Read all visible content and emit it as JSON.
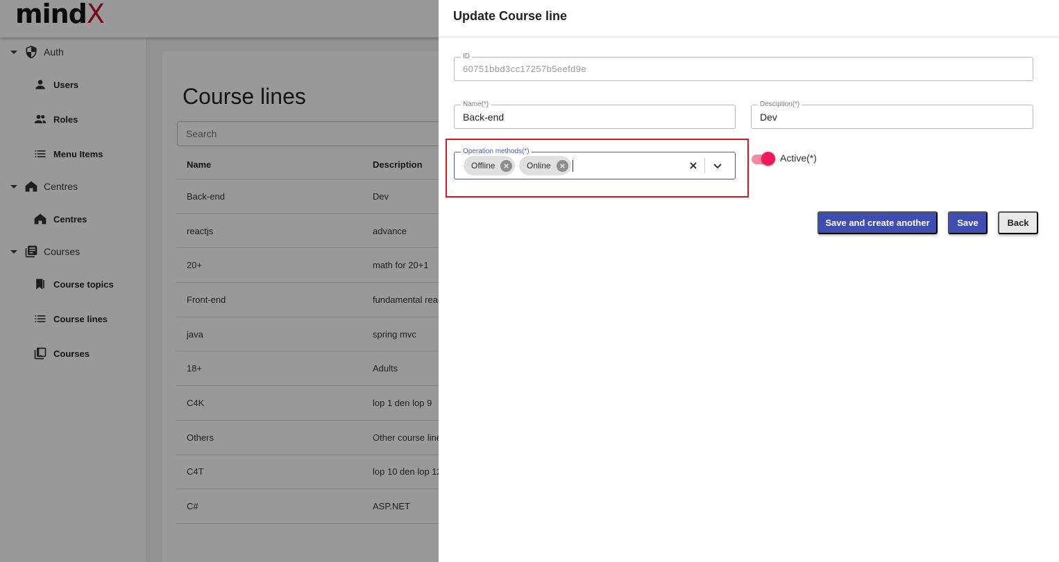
{
  "app": {
    "logo_text": "mind",
    "logo_x": "X"
  },
  "sidebar": {
    "groups": [
      {
        "label": "Auth",
        "icon": "shield-icon",
        "items": [
          {
            "label": "Users",
            "icon": "user-icon"
          },
          {
            "label": "Roles",
            "icon": "group-icon"
          },
          {
            "label": "Menu Items",
            "icon": "list-icon"
          }
        ]
      },
      {
        "label": "Centres",
        "icon": "house-icon",
        "items": [
          {
            "label": "Centres",
            "icon": "house-icon"
          }
        ]
      },
      {
        "label": "Courses",
        "icon": "library-icon",
        "items": [
          {
            "label": "Course topics",
            "icon": "bookmark-icon"
          },
          {
            "label": "Course lines",
            "icon": "list-icon"
          },
          {
            "label": "Courses",
            "icon": "library-icon"
          }
        ]
      }
    ]
  },
  "main": {
    "title": "Course lines",
    "search_placeholder": "Search",
    "columns": [
      "Name",
      "Description"
    ],
    "rows": [
      [
        "Back-end",
        "Dev"
      ],
      [
        "reactjs",
        "advance"
      ],
      [
        "20+",
        "math for 20+1"
      ],
      [
        "Front-end",
        "fundamental reac"
      ],
      [
        "java",
        "spring mvc"
      ],
      [
        "18+",
        "Adults"
      ],
      [
        "C4K",
        "lop 1 den lop 9"
      ],
      [
        "Others",
        "Other course line"
      ],
      [
        "C4T",
        "lop 10 den lop 12"
      ],
      [
        "C#",
        "ASP.NET"
      ]
    ]
  },
  "drawer": {
    "title": "Update Course line",
    "id_label": "ID",
    "id_value": "60751bbd3cc17257b5eefd9e",
    "name_label": "Name(*)",
    "name_value": "Back-end",
    "description_label": "Desciption(*)",
    "description_value": "Dev",
    "operation_label": "Operation methods(*)",
    "operation_chips": [
      "Offline",
      "Online"
    ],
    "active_label": "Active(*)",
    "active": true,
    "buttons": {
      "save_another": "Save and create another",
      "save": "Save",
      "back": "Back"
    },
    "colors": {
      "primary": "#3f4db3",
      "toggle": "#f0185a",
      "highlight": "#e0121d"
    }
  }
}
